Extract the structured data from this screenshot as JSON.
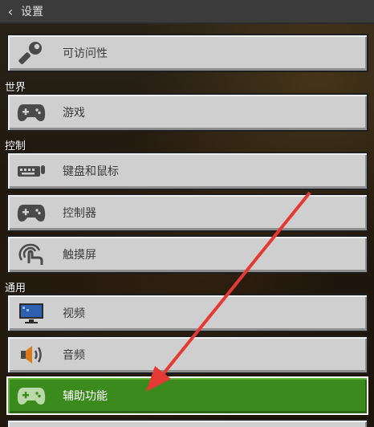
{
  "header": {
    "back_icon": "chevron-left-icon",
    "title": "设置"
  },
  "items": [
    {
      "label": "可访问性",
      "icon": "wrench-icon"
    },
    {
      "label": "游戏",
      "icon": "gamepad-icon"
    },
    {
      "label": "键盘和鼠标",
      "icon": "keyboard-icon"
    },
    {
      "label": "控制器",
      "icon": "gamepad-icon"
    },
    {
      "label": "触摸屏",
      "icon": "touch-icon"
    },
    {
      "label": "视频",
      "icon": "monitor-icon"
    },
    {
      "label": "音频",
      "icon": "speaker-icon"
    },
    {
      "label": "辅助功能",
      "icon": "gamepad-icon",
      "active": true
    }
  ],
  "sections": {
    "world": "世界",
    "controls": "控制",
    "general": "通用"
  },
  "colors": {
    "active": "#3b8a1e",
    "button": "#cfcfcf",
    "arrow": "#e53935"
  }
}
